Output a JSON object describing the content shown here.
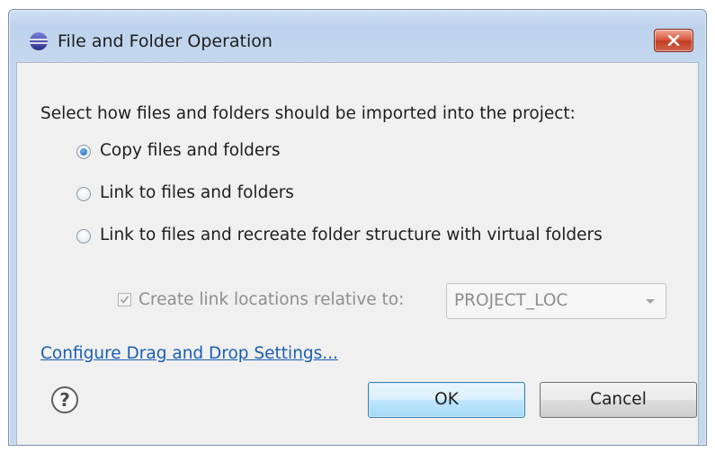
{
  "window": {
    "title": "File and Folder Operation",
    "close_icon": "close-x"
  },
  "prompt": "Select how files and folders should be imported into the project:",
  "options": [
    {
      "label": "Copy files and folders",
      "selected": true
    },
    {
      "label": "Link to files and folders",
      "selected": false
    },
    {
      "label": "Link to files and recreate folder structure with virtual folders",
      "selected": false
    }
  ],
  "relative_checkbox": {
    "label": "Create link locations relative to:",
    "checked": true,
    "enabled": false
  },
  "relative_combo": {
    "value": "PROJECT_LOC",
    "enabled": false
  },
  "configure_link": "Configure Drag and Drop Settings...",
  "help_icon": "?",
  "buttons": {
    "ok": "OK",
    "cancel": "Cancel"
  },
  "colors": {
    "link": "#1a5fb4",
    "close_button": "#c23b22",
    "default_button_border": "#3c7fb1",
    "disabled_text": "#8e8e8e"
  }
}
